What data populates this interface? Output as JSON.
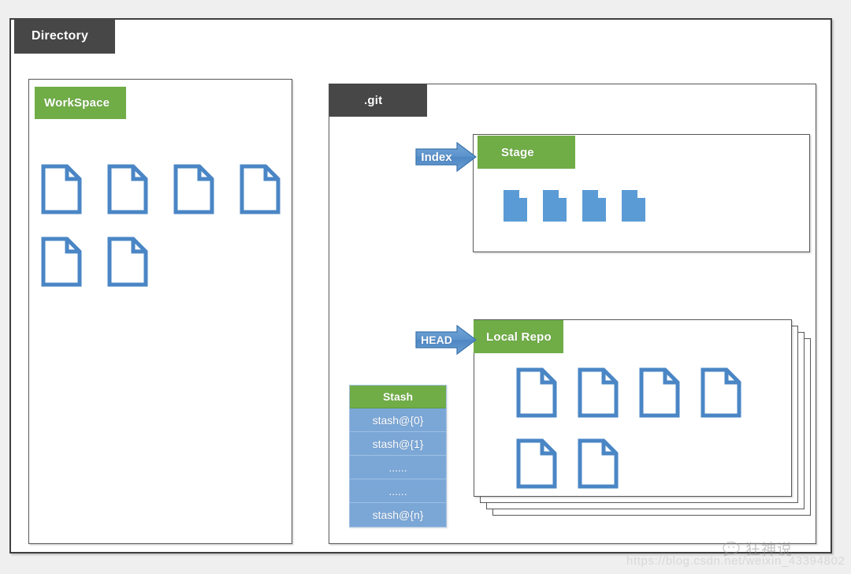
{
  "diagram": {
    "title": "Directory",
    "outer_container": {
      "label": "Directory",
      "tab_style": "dark"
    },
    "panels": [
      {
        "id": "workspace",
        "label": "WorkSpace",
        "tab_style": "green",
        "documents": {
          "count": 6,
          "style": "outline",
          "rows": [
            4,
            2
          ]
        }
      },
      {
        "id": "git",
        "label": ".git",
        "tab_style": "dark"
      },
      {
        "id": "stage",
        "label": "Stage",
        "tab_style": "green",
        "documents": {
          "count": 4,
          "style": "filled",
          "rows": [
            4
          ]
        }
      },
      {
        "id": "local-repo",
        "label": "Local Repo",
        "tab_style": "green",
        "stacked_sheets": 4,
        "documents": {
          "count": 6,
          "style": "outline",
          "rows": [
            4,
            2
          ]
        }
      }
    ],
    "arrows": [
      {
        "id": "index-arrow",
        "label": "Index",
        "points_to": "stage",
        "direction": "right"
      },
      {
        "id": "head-arrow",
        "label": "HEAD",
        "points_to": "local-repo",
        "direction": "right"
      }
    ],
    "stash": {
      "header": "Stash",
      "rows": [
        "stash@{0}",
        "stash@{1}",
        "......",
        "......",
        "stash@{n}"
      ]
    }
  },
  "watermark": {
    "logo_text": "狂神说",
    "url": "https://blog.csdn.net/weixin_43394802"
  },
  "colors": {
    "green": "#70AD47",
    "dark_gray": "#474747",
    "blue": "#5B9BD5",
    "stash_row_blue": "#7BA7D7",
    "page_background": "#efefef",
    "panel_border": "#585858"
  }
}
